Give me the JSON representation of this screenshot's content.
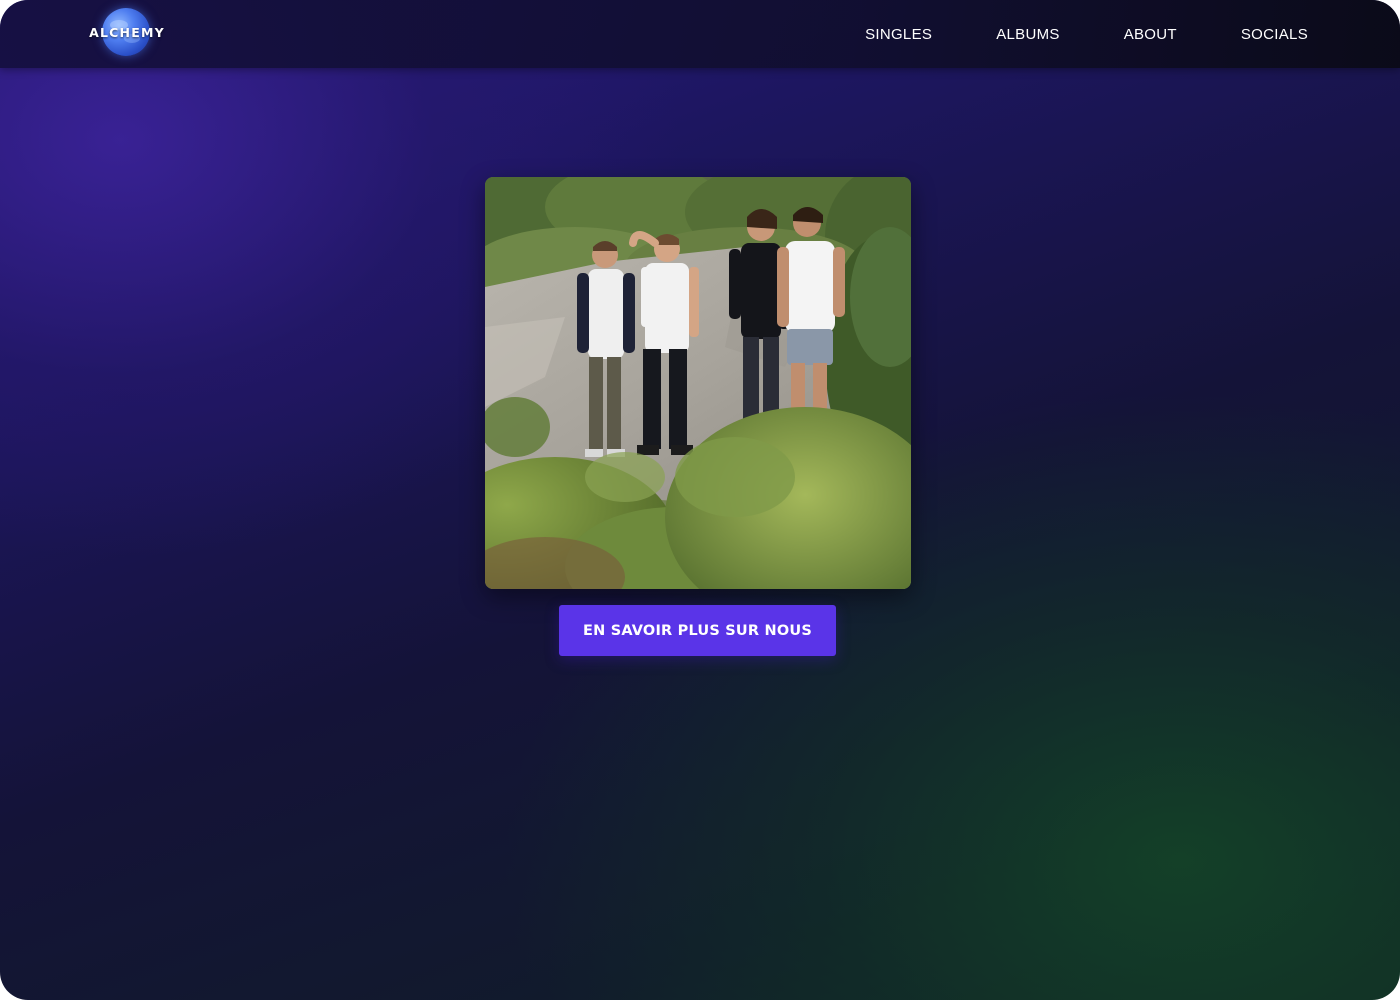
{
  "app": {
    "logo_text": "ALCHEMY",
    "accent_color": "#5a34e8"
  },
  "nav": {
    "items": [
      {
        "label": "SINGLES"
      },
      {
        "label": "ALBUMS"
      },
      {
        "label": "ABOUT"
      },
      {
        "label": "SOCIALS"
      }
    ]
  },
  "hero": {
    "image_alt": "band-photo",
    "cta_label": "EN SAVOIR PLUS SUR NOUS"
  }
}
